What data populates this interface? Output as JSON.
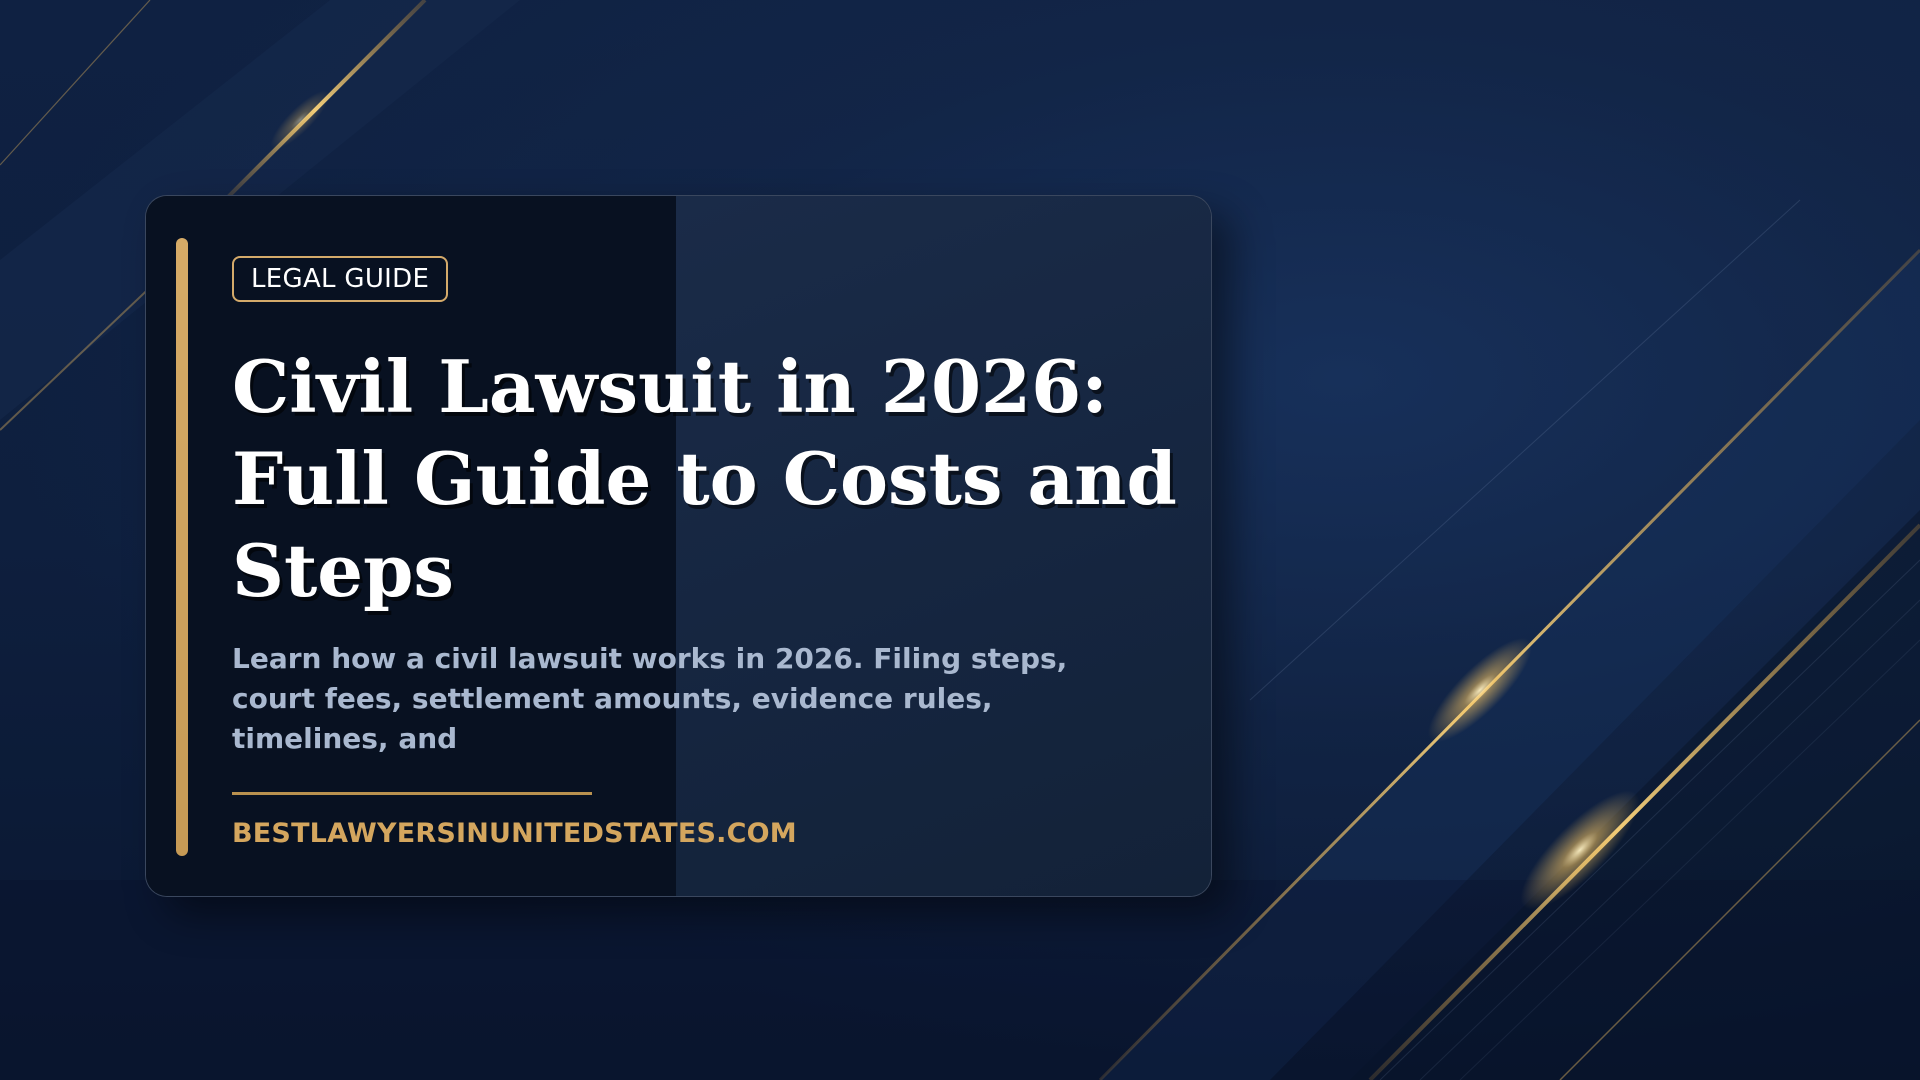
{
  "badge": "LEGAL GUIDE",
  "title": "Civil Lawsuit in 2026: Full Guide to Costs and Steps",
  "description": "Learn how a civil lawsuit works in 2026. Filing steps, court fees, settlement amounts, evidence rules, timelines, and",
  "website": "BESTLAWYERSINUNITEDSTATES.COM",
  "colors": {
    "background": "#0e1f3e",
    "accent_gold": "#d4a65e",
    "title": "#ffffff",
    "description": "#a9b8cf"
  }
}
